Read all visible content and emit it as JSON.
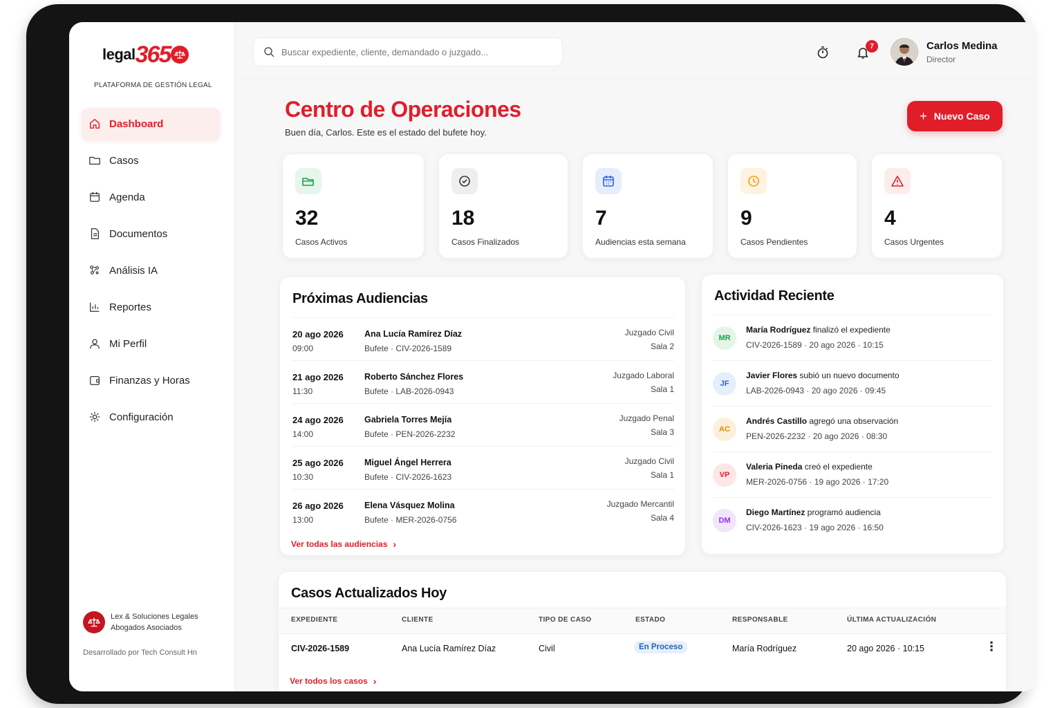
{
  "brand": {
    "logo_legal": "legal",
    "logo_365": "365",
    "subtitle": "PLATAFORMA DE GESTIÓN LEGAL"
  },
  "nav": [
    {
      "label": "Dashboard",
      "icon": "home-icon",
      "active": true
    },
    {
      "label": "Casos",
      "icon": "folder-icon"
    },
    {
      "label": "Agenda",
      "icon": "calendar-icon"
    },
    {
      "label": "Documentos",
      "icon": "document-icon"
    },
    {
      "label": "Análisis IA",
      "icon": "ai-icon"
    },
    {
      "label": "Reportes",
      "icon": "chart-icon"
    },
    {
      "label": "Mi Perfil",
      "icon": "user-icon"
    },
    {
      "label": "Finanzas y Horas",
      "icon": "wallet-icon"
    },
    {
      "label": "Configuración",
      "icon": "gear-icon"
    }
  ],
  "firm": {
    "line1": "Lex & Soluciones Legales",
    "line2": "Abogados Asociados",
    "developed_by": "Desarrollado por Tech Consult Hn"
  },
  "search": {
    "placeholder": "Buscar expediente, cliente, demandado o juzgado..."
  },
  "notifications": {
    "count": "7"
  },
  "user": {
    "name": "Carlos Medina",
    "role": "Director"
  },
  "header": {
    "title": "Centro de Operaciones",
    "subtitle": "Buen día, Carlos. Este es el estado del bufete hoy.",
    "new_case_label": "Nuevo Caso"
  },
  "stats": [
    {
      "value": "32",
      "label": "Casos Activos",
      "icon": "folder-open-icon",
      "color": "#16a34a",
      "bg": "#e6f6ea"
    },
    {
      "value": "18",
      "label": "Casos Finalizados",
      "icon": "check-circle-icon",
      "color": "#333333",
      "bg": "#eeeeee"
    },
    {
      "value": "7",
      "label": "Audiencias esta semana",
      "icon": "calendar-icon",
      "color": "#2563eb",
      "bg": "#e6eefc"
    },
    {
      "value": "9",
      "label": "Casos Pendientes",
      "icon": "clock-icon",
      "color": "#f59e0b",
      "bg": "#fdf3e0"
    },
    {
      "value": "4",
      "label": "Casos Urgentes",
      "icon": "alert-icon",
      "color": "#e11d2a",
      "bg": "#fdecec"
    }
  ],
  "hearings": {
    "title": "Próximas Audiencias",
    "link": "Ver todas las audiencias",
    "items": [
      {
        "date": "20 ago 2026",
        "time": "09:00",
        "name": "Ana Lucía Ramírez Díaz",
        "case": "Bufete · CIV-2026-1589",
        "court": "Juzgado Civil",
        "room": "Sala 2"
      },
      {
        "date": "21 ago 2026",
        "time": "11:30",
        "name": "Roberto Sánchez Flores",
        "case": "Bufete · LAB-2026-0943",
        "court": "Juzgado Laboral",
        "room": "Sala 1"
      },
      {
        "date": "24 ago 2026",
        "time": "14:00",
        "name": "Gabriela Torres Mejía",
        "case": "Bufete · PEN-2026-2232",
        "court": "Juzgado Penal",
        "room": "Sala 3"
      },
      {
        "date": "25 ago 2026",
        "time": "10:30",
        "name": "Miguel Ángel Herrera",
        "case": "Bufete · CIV-2026-1623",
        "court": "Juzgado Civil",
        "room": "Sala 1"
      },
      {
        "date": "26 ago 2026",
        "time": "13:00",
        "name": "Elena Vásquez Molina",
        "case": "Bufete · MER-2026-0756",
        "court": "Juzgado Mercantil",
        "room": "Sala 4"
      }
    ]
  },
  "activity": {
    "title": "Actividad Reciente",
    "items": [
      {
        "initials": "MR",
        "name": "María Rodríguez",
        "action": " finalizó el expediente",
        "meta": "CIV-2026-1589 · 20 ago 2026 · 10:15",
        "color": "#16a34a",
        "bg": "#e4f5e8"
      },
      {
        "initials": "JF",
        "name": "Javier Flores",
        "action": " subió un nuevo documento",
        "meta": "LAB-2026-0943 · 20 ago 2026 · 09:45",
        "color": "#2563eb",
        "bg": "#e6eefc"
      },
      {
        "initials": "AC",
        "name": "Andrés Castillo",
        "action": " agregó una observación",
        "meta": "PEN-2026-2232 · 20 ago 2026 · 08:30",
        "color": "#e08a00",
        "bg": "#fdf0da"
      },
      {
        "initials": "VP",
        "name": "Valeria Pineda",
        "action": " creó el expediente",
        "meta": "MER-2026-0756 · 19 ago 2026 · 17:20",
        "color": "#e11d2a",
        "bg": "#fde6e7"
      },
      {
        "initials": "DM",
        "name": "Diego Martínez",
        "action": " programó audiencia",
        "meta": "CIV-2026-1623 · 19 ago 2026 · 16:50",
        "color": "#9333ea",
        "bg": "#f1e6fc"
      }
    ]
  },
  "cases_today": {
    "title": "Casos Actualizados Hoy",
    "columns": [
      "EXPEDIENTE",
      "CLIENTE",
      "TIPO DE CASO",
      "ESTADO",
      "RESPONSABLE",
      "ÚLTIMA ACTUALIZACIÓN"
    ],
    "rows": [
      {
        "expediente": "CIV-2026-1589",
        "cliente": "Ana Lucía Ramírez Díaz",
        "tipo": "Civil",
        "estado": "En Proceso",
        "responsable": "María Rodríguez",
        "actualizacion": "20 ago 2026 · 10:15"
      }
    ],
    "link": "Ver todos los casos"
  }
}
